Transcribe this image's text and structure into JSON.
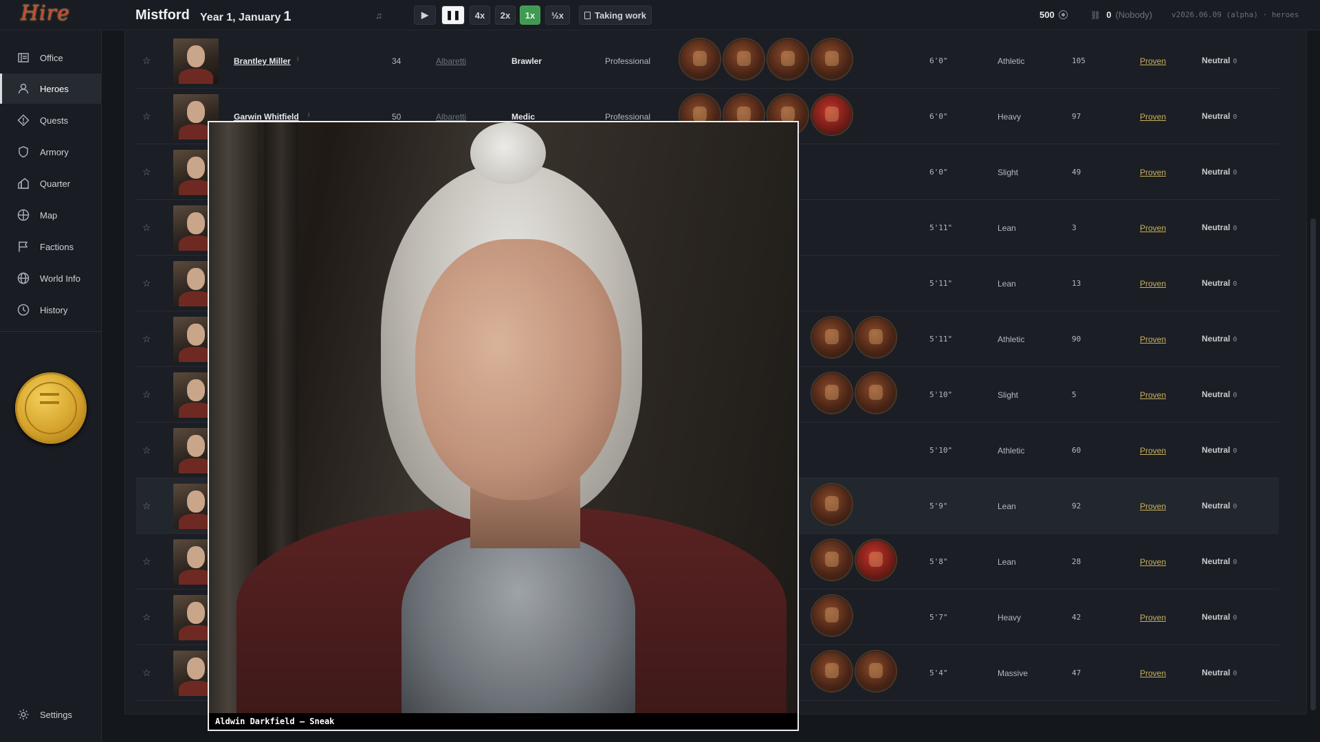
{
  "header": {
    "logo_text": "Hire",
    "town": "Mistford",
    "date": "Year 1, January",
    "day": "1",
    "music_icon": "music-note-icon",
    "speed_buttons": [
      {
        "label": "▶",
        "name": "play-button"
      },
      {
        "label": "❚❚",
        "name": "pause-button"
      },
      {
        "label": "4x",
        "name": "speed-4x-button"
      },
      {
        "label": "2x",
        "name": "speed-2x-button"
      },
      {
        "label": "1x",
        "name": "speed-1x-button"
      },
      {
        "label": "½x",
        "name": "speed-half-button"
      }
    ],
    "taking_work": "Taking work",
    "gold": "500",
    "renown_value": "0",
    "renown_name": "(Nobody)",
    "version": "v2026.06.09 (alpha) · heroes"
  },
  "sidebar": {
    "items": [
      {
        "label": "Office",
        "icon": "office-icon"
      },
      {
        "label": "Heroes",
        "icon": "person-icon"
      },
      {
        "label": "Quests",
        "icon": "quest-diamond-icon"
      },
      {
        "label": "Armory",
        "icon": "shield-icon"
      },
      {
        "label": "Quarter",
        "icon": "house-icon"
      },
      {
        "label": "Map",
        "icon": "globe-icon"
      },
      {
        "label": "Factions",
        "icon": "flag-icon"
      },
      {
        "label": "World Info",
        "icon": "world-icon"
      },
      {
        "label": "History",
        "icon": "clock-icon"
      }
    ],
    "active": "Heroes",
    "settings_label": "Settings"
  },
  "heroes": {
    "rows": [
      {
        "name": "Brantley Miller",
        "info": "i",
        "age": "34",
        "house": "Albaretti",
        "class": "Brawler",
        "rank": "Professional",
        "height": "6'0\"",
        "build": "Athletic",
        "score": "105",
        "status": "Proven",
        "alignment": "Neutral",
        "align_value": "0"
      },
      {
        "name": "Garwin Whitfield",
        "info": "i",
        "age": "50",
        "house": "Albaretti",
        "class": "Medic",
        "rank": "Professional",
        "height": "6'0\"",
        "build": "Heavy",
        "score": "97",
        "status": "Proven",
        "alignment": "Neutral",
        "align_value": "0"
      },
      {
        "height": "6'0\"",
        "build": "Slight",
        "score": "49",
        "status": "Proven",
        "alignment": "Neutral",
        "align_value": "0"
      },
      {
        "height": "5'11\"",
        "build": "Lean",
        "score": "3",
        "status": "Proven",
        "alignment": "Neutral",
        "align_value": "0"
      },
      {
        "height": "5'11\"",
        "build": "Lean",
        "score": "13",
        "status": "Proven",
        "alignment": "Neutral",
        "align_value": "0"
      },
      {
        "height": "5'11\"",
        "build": "Athletic",
        "score": "90",
        "status": "Proven",
        "alignment": "Neutral",
        "align_value": "0"
      },
      {
        "height": "5'10\"",
        "build": "Slight",
        "score": "5",
        "status": "Proven",
        "alignment": "Neutral",
        "align_value": "0"
      },
      {
        "height": "5'10\"",
        "build": "Athletic",
        "score": "60",
        "status": "Proven",
        "alignment": "Neutral",
        "align_value": "0"
      },
      {
        "height": "5'9\"",
        "build": "Lean",
        "score": "92",
        "status": "Proven",
        "alignment": "Neutral",
        "align_value": "0"
      },
      {
        "height": "5'8\"",
        "build": "Lean",
        "score": "28",
        "status": "Proven",
        "alignment": "Neutral",
        "align_value": "0"
      },
      {
        "height": "5'7\"",
        "build": "Heavy",
        "score": "42",
        "status": "Proven",
        "alignment": "Neutral",
        "align_value": "0"
      },
      {
        "height": "5'4\"",
        "build": "Massive",
        "score": "47",
        "status": "Proven",
        "alignment": "Neutral",
        "align_value": "0"
      }
    ]
  },
  "popup": {
    "caption": "Aldwin Darkfield — Sneak"
  }
}
